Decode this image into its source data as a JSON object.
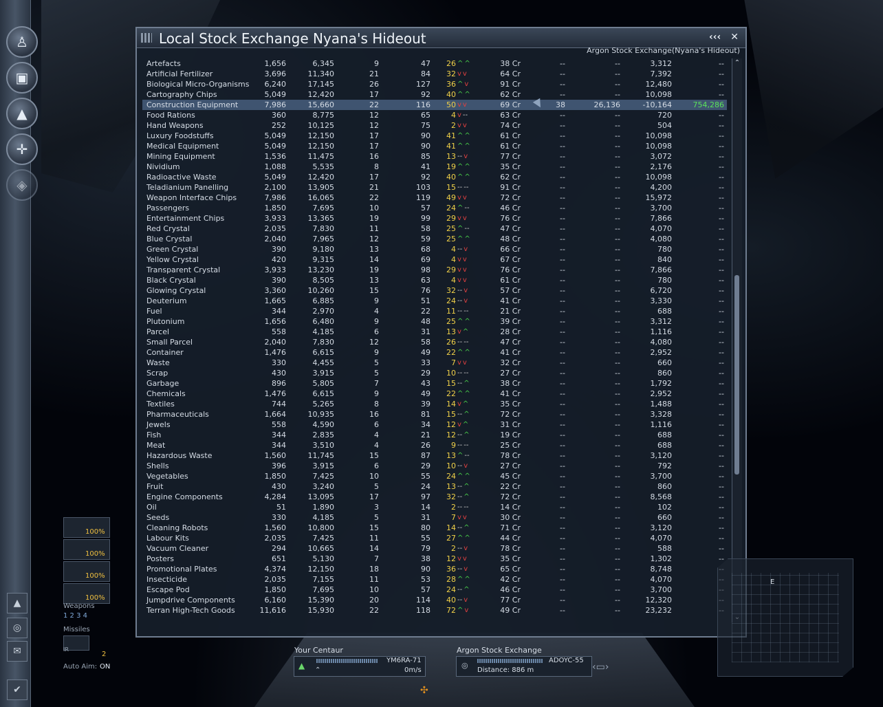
{
  "window": {
    "title": "Local Stock Exchange Nyana's Hideout",
    "subtitle": "Argon Stock Exchange(Nyana's Hideout)",
    "collapse_btn": "‹‹‹",
    "close_btn": "✕"
  },
  "rows": [
    {
      "name": "Artefacts",
      "min": "1,656",
      "max": "6,345",
      "a": "9",
      "b": "47",
      "cur": "26",
      "t1": "^",
      "t2": "^",
      "cr": "38 Cr",
      "d1": "--",
      "d2": "--",
      "v": "3,312",
      "p": "--"
    },
    {
      "name": "Artificial Fertilizer",
      "min": "3,696",
      "max": "11,340",
      "a": "21",
      "b": "84",
      "cur": "32",
      "t1": "v",
      "t2": "v",
      "cr": "64 Cr",
      "d1": "--",
      "d2": "--",
      "v": "7,392",
      "p": "--"
    },
    {
      "name": "Biological Micro-Organisms",
      "min": "6,240",
      "max": "17,145",
      "a": "26",
      "b": "127",
      "cur": "36",
      "t1": "^",
      "t2": "v",
      "cr": "91 Cr",
      "d1": "--",
      "d2": "--",
      "v": "12,480",
      "p": "--"
    },
    {
      "name": "Cartography Chips",
      "min": "5,049",
      "max": "12,420",
      "a": "17",
      "b": "92",
      "cur": "40",
      "t1": "^",
      "t2": "^",
      "cr": "62 Cr",
      "d1": "--",
      "d2": "--",
      "v": "10,098",
      "p": "--"
    },
    {
      "name": "Construction Equipment",
      "min": "7,986",
      "max": "15,660",
      "a": "22",
      "b": "116",
      "cur": "50",
      "t1": "v",
      "t2": "v",
      "cr": "69 Cr",
      "d1": "38",
      "d2": "26,136",
      "v": "-10,164",
      "p": "754,286",
      "selected": true
    },
    {
      "name": "Food Rations",
      "min": "360",
      "max": "8,775",
      "a": "12",
      "b": "65",
      "cur": "4",
      "t1": "v",
      "t2": "--",
      "cr": "63 Cr",
      "d1": "--",
      "d2": "--",
      "v": "720",
      "p": "--"
    },
    {
      "name": "Hand Weapons",
      "min": "252",
      "max": "10,125",
      "a": "12",
      "b": "75",
      "cur": "2",
      "t1": "v",
      "t2": "v",
      "cr": "74 Cr",
      "d1": "--",
      "d2": "--",
      "v": "504",
      "p": "--"
    },
    {
      "name": "Luxury Foodstuffs",
      "min": "5,049",
      "max": "12,150",
      "a": "17",
      "b": "90",
      "cur": "41",
      "t1": "^",
      "t2": "^",
      "cr": "61 Cr",
      "d1": "--",
      "d2": "--",
      "v": "10,098",
      "p": "--"
    },
    {
      "name": "Medical Equipment",
      "min": "5,049",
      "max": "12,150",
      "a": "17",
      "b": "90",
      "cur": "41",
      "t1": "^",
      "t2": "^",
      "cr": "61 Cr",
      "d1": "--",
      "d2": "--",
      "v": "10,098",
      "p": "--"
    },
    {
      "name": "Mining Equipment",
      "min": "1,536",
      "max": "11,475",
      "a": "16",
      "b": "85",
      "cur": "13",
      "t1": "--",
      "t2": "v",
      "cr": "77 Cr",
      "d1": "--",
      "d2": "--",
      "v": "3,072",
      "p": "--"
    },
    {
      "name": "Nividium",
      "min": "1,088",
      "max": "5,535",
      "a": "8",
      "b": "41",
      "cur": "19",
      "t1": "^",
      "t2": "^",
      "cr": "35 Cr",
      "d1": "--",
      "d2": "--",
      "v": "2,176",
      "p": "--"
    },
    {
      "name": "Radioactive Waste",
      "min": "5,049",
      "max": "12,420",
      "a": "17",
      "b": "92",
      "cur": "40",
      "t1": "^",
      "t2": "^",
      "cr": "62 Cr",
      "d1": "--",
      "d2": "--",
      "v": "10,098",
      "p": "--"
    },
    {
      "name": "Teladianium Panelling",
      "min": "2,100",
      "max": "13,905",
      "a": "21",
      "b": "103",
      "cur": "15",
      "t1": "--",
      "t2": "--",
      "cr": "91 Cr",
      "d1": "--",
      "d2": "--",
      "v": "4,200",
      "p": "--"
    },
    {
      "name": "Weapon Interface Chips",
      "min": "7,986",
      "max": "16,065",
      "a": "22",
      "b": "119",
      "cur": "49",
      "t1": "v",
      "t2": "v",
      "cr": "72 Cr",
      "d1": "--",
      "d2": "--",
      "v": "15,972",
      "p": "--"
    },
    {
      "name": "Passengers",
      "min": "1,850",
      "max": "7,695",
      "a": "10",
      "b": "57",
      "cur": "24",
      "t1": "^",
      "t2": "--",
      "cr": "46 Cr",
      "d1": "--",
      "d2": "--",
      "v": "3,700",
      "p": "--"
    },
    {
      "name": "Entertainment Chips",
      "min": "3,933",
      "max": "13,365",
      "a": "19",
      "b": "99",
      "cur": "29",
      "t1": "v",
      "t2": "v",
      "cr": "76 Cr",
      "d1": "--",
      "d2": "--",
      "v": "7,866",
      "p": "--"
    },
    {
      "name": "Red Crystal",
      "min": "2,035",
      "max": "7,830",
      "a": "11",
      "b": "58",
      "cur": "25",
      "t1": "^",
      "t2": "--",
      "cr": "47 Cr",
      "d1": "--",
      "d2": "--",
      "v": "4,070",
      "p": "--"
    },
    {
      "name": "Blue Crystal",
      "min": "2,040",
      "max": "7,965",
      "a": "12",
      "b": "59",
      "cur": "25",
      "t1": "^",
      "t2": "^",
      "cr": "48 Cr",
      "d1": "--",
      "d2": "--",
      "v": "4,080",
      "p": "--"
    },
    {
      "name": "Green Crystal",
      "min": "390",
      "max": "9,180",
      "a": "13",
      "b": "68",
      "cur": "4",
      "t1": "--",
      "t2": "v",
      "cr": "66 Cr",
      "d1": "--",
      "d2": "--",
      "v": "780",
      "p": "--"
    },
    {
      "name": "Yellow Crystal",
      "min": "420",
      "max": "9,315",
      "a": "14",
      "b": "69",
      "cur": "4",
      "t1": "v",
      "t2": "v",
      "cr": "67 Cr",
      "d1": "--",
      "d2": "--",
      "v": "840",
      "p": "--"
    },
    {
      "name": "Transparent Crystal",
      "min": "3,933",
      "max": "13,230",
      "a": "19",
      "b": "98",
      "cur": "29",
      "t1": "v",
      "t2": "v",
      "cr": "76 Cr",
      "d1": "--",
      "d2": "--",
      "v": "7,866",
      "p": "--"
    },
    {
      "name": "Black Crystal",
      "min": "390",
      "max": "8,505",
      "a": "13",
      "b": "63",
      "cur": "4",
      "t1": "v",
      "t2": "v",
      "cr": "61 Cr",
      "d1": "--",
      "d2": "--",
      "v": "780",
      "p": "--"
    },
    {
      "name": "Glowing Crystal",
      "min": "3,360",
      "max": "10,260",
      "a": "15",
      "b": "76",
      "cur": "32",
      "t1": "--",
      "t2": "v",
      "cr": "57 Cr",
      "d1": "--",
      "d2": "--",
      "v": "6,720",
      "p": "--"
    },
    {
      "name": "Deuterium",
      "min": "1,665",
      "max": "6,885",
      "a": "9",
      "b": "51",
      "cur": "24",
      "t1": "--",
      "t2": "v",
      "cr": "41 Cr",
      "d1": "--",
      "d2": "--",
      "v": "3,330",
      "p": "--"
    },
    {
      "name": "Fuel",
      "min": "344",
      "max": "2,970",
      "a": "4",
      "b": "22",
      "cur": "11",
      "t1": "--",
      "t2": "--",
      "cr": "21 Cr",
      "d1": "--",
      "d2": "--",
      "v": "688",
      "p": "--"
    },
    {
      "name": "Plutonium",
      "min": "1,656",
      "max": "6,480",
      "a": "9",
      "b": "48",
      "cur": "25",
      "t1": "^",
      "t2": "^",
      "cr": "39 Cr",
      "d1": "--",
      "d2": "--",
      "v": "3,312",
      "p": "--"
    },
    {
      "name": "Parcel",
      "min": "558",
      "max": "4,185",
      "a": "6",
      "b": "31",
      "cur": "13",
      "t1": "v",
      "t2": "^",
      "cr": "28 Cr",
      "d1": "--",
      "d2": "--",
      "v": "1,116",
      "p": "--"
    },
    {
      "name": "Small Parcel",
      "min": "2,040",
      "max": "7,830",
      "a": "12",
      "b": "58",
      "cur": "26",
      "t1": "--",
      "t2": "--",
      "cr": "47 Cr",
      "d1": "--",
      "d2": "--",
      "v": "4,080",
      "p": "--"
    },
    {
      "name": "Container",
      "min": "1,476",
      "max": "6,615",
      "a": "9",
      "b": "49",
      "cur": "22",
      "t1": "^",
      "t2": "^",
      "cr": "41 Cr",
      "d1": "--",
      "d2": "--",
      "v": "2,952",
      "p": "--"
    },
    {
      "name": "Waste",
      "min": "330",
      "max": "4,455",
      "a": "5",
      "b": "33",
      "cur": "7",
      "t1": "v",
      "t2": "v",
      "cr": "32 Cr",
      "d1": "--",
      "d2": "--",
      "v": "660",
      "p": "--"
    },
    {
      "name": "Scrap",
      "min": "430",
      "max": "3,915",
      "a": "5",
      "b": "29",
      "cur": "10",
      "t1": "--",
      "t2": "--",
      "cr": "27 Cr",
      "d1": "--",
      "d2": "--",
      "v": "860",
      "p": "--"
    },
    {
      "name": "Garbage",
      "min": "896",
      "max": "5,805",
      "a": "7",
      "b": "43",
      "cur": "15",
      "t1": "--",
      "t2": "^",
      "cr": "38 Cr",
      "d1": "--",
      "d2": "--",
      "v": "1,792",
      "p": "--"
    },
    {
      "name": "Chemicals",
      "min": "1,476",
      "max": "6,615",
      "a": "9",
      "b": "49",
      "cur": "22",
      "t1": "^",
      "t2": "^",
      "cr": "41 Cr",
      "d1": "--",
      "d2": "--",
      "v": "2,952",
      "p": "--"
    },
    {
      "name": "Textiles",
      "min": "744",
      "max": "5,265",
      "a": "8",
      "b": "39",
      "cur": "14",
      "t1": "v",
      "t2": "^",
      "cr": "35 Cr",
      "d1": "--",
      "d2": "--",
      "v": "1,488",
      "p": "--"
    },
    {
      "name": "Pharmaceuticals",
      "min": "1,664",
      "max": "10,935",
      "a": "16",
      "b": "81",
      "cur": "15",
      "t1": "--",
      "t2": "^",
      "cr": "72 Cr",
      "d1": "--",
      "d2": "--",
      "v": "3,328",
      "p": "--"
    },
    {
      "name": "Jewels",
      "min": "558",
      "max": "4,590",
      "a": "6",
      "b": "34",
      "cur": "12",
      "t1": "v",
      "t2": "^",
      "cr": "31 Cr",
      "d1": "--",
      "d2": "--",
      "v": "1,116",
      "p": "--"
    },
    {
      "name": "Fish",
      "min": "344",
      "max": "2,835",
      "a": "4",
      "b": "21",
      "cur": "12",
      "t1": "--",
      "t2": "^",
      "cr": "19 Cr",
      "d1": "--",
      "d2": "--",
      "v": "688",
      "p": "--"
    },
    {
      "name": "Meat",
      "min": "344",
      "max": "3,510",
      "a": "4",
      "b": "26",
      "cur": "9",
      "t1": "--",
      "t2": "--",
      "cr": "25 Cr",
      "d1": "--",
      "d2": "--",
      "v": "688",
      "p": "--"
    },
    {
      "name": "Hazardous Waste",
      "min": "1,560",
      "max": "11,745",
      "a": "15",
      "b": "87",
      "cur": "13",
      "t1": "^",
      "t2": "--",
      "cr": "78 Cr",
      "d1": "--",
      "d2": "--",
      "v": "3,120",
      "p": "--"
    },
    {
      "name": "Shells",
      "min": "396",
      "max": "3,915",
      "a": "6",
      "b": "29",
      "cur": "10",
      "t1": "--",
      "t2": "v",
      "cr": "27 Cr",
      "d1": "--",
      "d2": "--",
      "v": "792",
      "p": "--"
    },
    {
      "name": "Vegetables",
      "min": "1,850",
      "max": "7,425",
      "a": "10",
      "b": "55",
      "cur": "24",
      "t1": "^",
      "t2": "^",
      "cr": "45 Cr",
      "d1": "--",
      "d2": "--",
      "v": "3,700",
      "p": "--"
    },
    {
      "name": "Fruit",
      "min": "430",
      "max": "3,240",
      "a": "5",
      "b": "24",
      "cur": "13",
      "t1": "--",
      "t2": "^",
      "cr": "22 Cr",
      "d1": "--",
      "d2": "--",
      "v": "860",
      "p": "--"
    },
    {
      "name": "Engine Components",
      "min": "4,284",
      "max": "13,095",
      "a": "17",
      "b": "97",
      "cur": "32",
      "t1": "--",
      "t2": "^",
      "cr": "72 Cr",
      "d1": "--",
      "d2": "--",
      "v": "8,568",
      "p": "--"
    },
    {
      "name": "Oil",
      "min": "51",
      "max": "1,890",
      "a": "3",
      "b": "14",
      "cur": "2",
      "t1": "--",
      "t2": "--",
      "cr": "14 Cr",
      "d1": "--",
      "d2": "--",
      "v": "102",
      "p": "--"
    },
    {
      "name": "Seeds",
      "min": "330",
      "max": "4,185",
      "a": "5",
      "b": "31",
      "cur": "7",
      "t1": "v",
      "t2": "v",
      "cr": "30 Cr",
      "d1": "--",
      "d2": "--",
      "v": "660",
      "p": "--"
    },
    {
      "name": "Cleaning Robots",
      "min": "1,560",
      "max": "10,800",
      "a": "15",
      "b": "80",
      "cur": "14",
      "t1": "--",
      "t2": "^",
      "cr": "71 Cr",
      "d1": "--",
      "d2": "--",
      "v": "3,120",
      "p": "--"
    },
    {
      "name": "Labour Kits",
      "min": "2,035",
      "max": "7,425",
      "a": "11",
      "b": "55",
      "cur": "27",
      "t1": "^",
      "t2": "^",
      "cr": "44 Cr",
      "d1": "--",
      "d2": "--",
      "v": "4,070",
      "p": "--"
    },
    {
      "name": "Vacuum Cleaner",
      "min": "294",
      "max": "10,665",
      "a": "14",
      "b": "79",
      "cur": "2",
      "t1": "--",
      "t2": "v",
      "cr": "78 Cr",
      "d1": "--",
      "d2": "--",
      "v": "588",
      "p": "--"
    },
    {
      "name": "Posters",
      "min": "651",
      "max": "5,130",
      "a": "7",
      "b": "38",
      "cur": "12",
      "t1": "v",
      "t2": "v",
      "cr": "35 Cr",
      "d1": "--",
      "d2": "--",
      "v": "1,302",
      "p": "--"
    },
    {
      "name": "Promotional Plates",
      "min": "4,374",
      "max": "12,150",
      "a": "18",
      "b": "90",
      "cur": "36",
      "t1": "--",
      "t2": "v",
      "cr": "65 Cr",
      "d1": "--",
      "d2": "--",
      "v": "8,748",
      "p": "--"
    },
    {
      "name": "Insecticide",
      "min": "2,035",
      "max": "7,155",
      "a": "11",
      "b": "53",
      "cur": "28",
      "t1": "^",
      "t2": "^",
      "cr": "42 Cr",
      "d1": "--",
      "d2": "--",
      "v": "4,070",
      "p": "--"
    },
    {
      "name": "Escape Pod",
      "min": "1,850",
      "max": "7,695",
      "a": "10",
      "b": "57",
      "cur": "24",
      "t1": "--",
      "t2": "^",
      "cr": "46 Cr",
      "d1": "--",
      "d2": "--",
      "v": "3,700",
      "p": "--"
    },
    {
      "name": "Jumpdrive Components",
      "min": "6,160",
      "max": "15,390",
      "a": "20",
      "b": "114",
      "cur": "40",
      "t1": "--",
      "t2": "v",
      "cr": "77 Cr",
      "d1": "--",
      "d2": "--",
      "v": "12,320",
      "p": "--"
    },
    {
      "name": "Terran High-Tech Goods",
      "min": "11,616",
      "max": "15,930",
      "a": "22",
      "b": "118",
      "cur": "72",
      "t1": "^",
      "t2": "v",
      "cr": "49 Cr",
      "d1": "--",
      "d2": "--",
      "v": "23,232",
      "p": "--"
    }
  ],
  "weapons_panel": {
    "percents": [
      "100%",
      "100%",
      "100%",
      "100%"
    ],
    "weapons_label": "Weapons",
    "weapon_groups": "1 2 3 4",
    "missiles_label": "Missiles",
    "ir_label": "IR",
    "missile_count": "2",
    "auto_aim_label": "Auto Aim:",
    "auto_aim_value": "ON"
  },
  "hud": {
    "ship_label": "Your Centaur",
    "ship_code": "YM6RA-71",
    "speed": "0m/s",
    "target_label": "Argon Stock Exchange",
    "target_code": "ADOYC-55",
    "distance": "Distance: 886 m",
    "radar_label": "E"
  },
  "colors": {
    "up": "#4bd64b",
    "down": "#e04040",
    "current": "#f0d048",
    "selected_row": "#3f5470",
    "profit": "#5be35b"
  }
}
